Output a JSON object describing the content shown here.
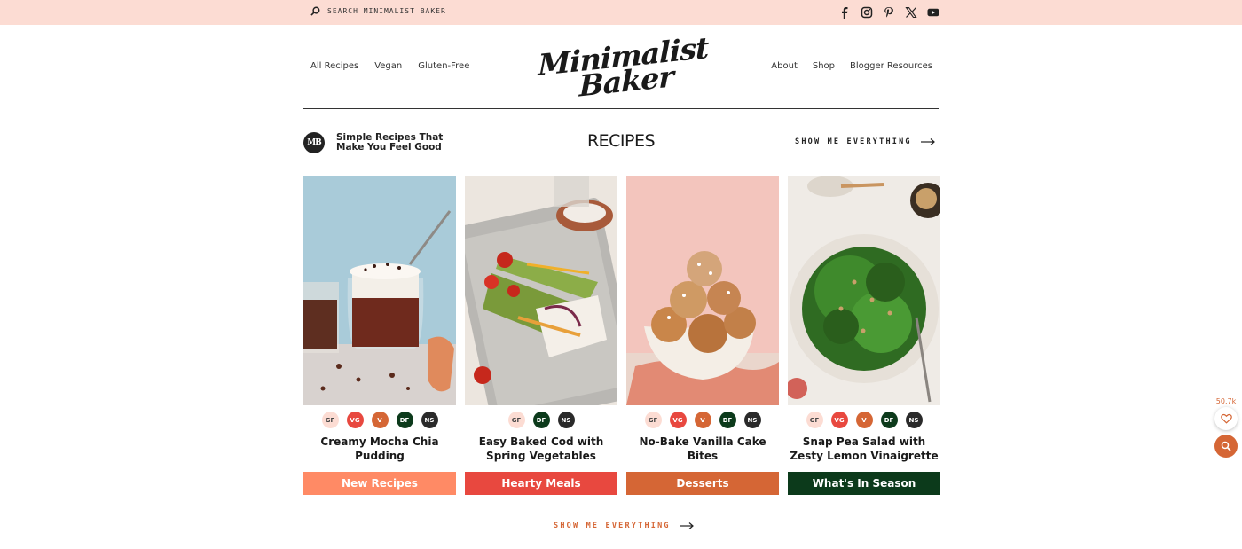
{
  "colors": {
    "topbar_bg": "#fcdcd3",
    "accent": "#d56635",
    "coral": "#ff8a65",
    "red": "#e8483f",
    "green": "#0c3a1b"
  },
  "topbar": {
    "search_placeholder": "SEARCH MINIMALIST BAKER",
    "social_icons": [
      "facebook-icon",
      "instagram-icon",
      "pinterest-icon",
      "x-icon",
      "youtube-icon"
    ]
  },
  "nav": {
    "left": [
      "All Recipes",
      "Vegan",
      "Gluten-Free"
    ],
    "right": [
      "About",
      "Shop",
      "Blogger Resources"
    ]
  },
  "logo": {
    "line1": "Minimalist",
    "line2": "Baker"
  },
  "section": {
    "badge": "MB",
    "tagline_line1": "Simple Recipes That",
    "tagline_line2": "Make You Feel Good",
    "title": "RECIPES",
    "show_everything": "SHOW ME EVERYTHING"
  },
  "cards": [
    {
      "title": "Creamy Mocha Chia Pudding",
      "diets": [
        "GF",
        "VG",
        "V",
        "DF",
        "NS"
      ],
      "category": "New Recipes",
      "category_color": "#ff8a65"
    },
    {
      "title": "Easy Baked Cod with Spring Vegetables",
      "diets": [
        "GF",
        "DF",
        "NS"
      ],
      "category": "Hearty Meals",
      "category_color": "#e8483f"
    },
    {
      "title": "No-Bake Vanilla Cake Bites",
      "diets": [
        "GF",
        "VG",
        "V",
        "DF",
        "NS"
      ],
      "category": "Desserts",
      "category_color": "#d56635"
    },
    {
      "title": "Snap Pea Salad with Zesty Lemon Vinaigrette",
      "diets": [
        "GF",
        "VG",
        "V",
        "DF",
        "NS"
      ],
      "category": "What's In Season",
      "category_color": "#0c3a1b"
    }
  ],
  "bottom": {
    "show_everything": "SHOW ME EVERYTHING"
  },
  "floating": {
    "favorites_count": "50.7k"
  }
}
